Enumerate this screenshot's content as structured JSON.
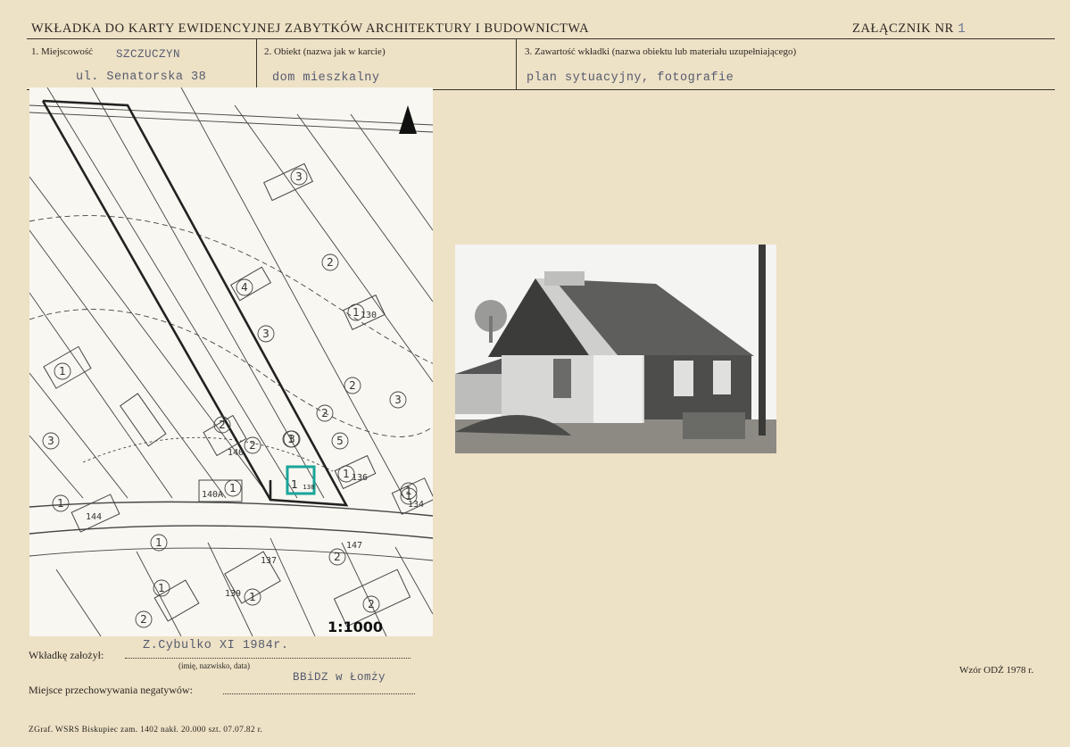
{
  "header": {
    "title": "WKŁADKA DO KARTY EWIDENCYJNEJ ZABYTKÓW ARCHITEKTURY I BUDOWNICTWA",
    "annex_label": "ZAŁĄCZNIK NR",
    "annex_number": "1"
  },
  "fields": {
    "locality_label": "1. Miejscowość",
    "locality_value": "SZCZUCZYN",
    "address_value": "ul. Senatorska 38",
    "object_label": "2. Obiekt (nazwa jak w karcie)",
    "object_value": "dom mieszkalny",
    "contents_label": "3. Zawartość wkładki (nazwa obiektu lub materiału uzupełniającego)",
    "contents_value": "plan sytuacyjny, fotografie"
  },
  "map": {
    "scale": "1:1000",
    "parcel_labels": [
      "3",
      "2",
      "4",
      "3",
      "1",
      "2",
      "3",
      "2",
      "5",
      "3",
      "1",
      "2",
      "1",
      "2",
      "1",
      "1",
      "3",
      "1",
      "1",
      "2",
      "1",
      "2",
      "1",
      "1",
      "2",
      "1"
    ],
    "house_numbers": [
      "130",
      "136",
      "134",
      "140",
      "140A",
      "144",
      "147",
      "137",
      "139"
    ],
    "highlighted_parcel": "1",
    "highlighted_number": "138"
  },
  "footer_fields": {
    "founder_label": "Wkładkę założył:",
    "founder_value": "Z.Cybulko XI 1984r.",
    "founder_caption": "(imię, nazwisko, data)",
    "storage_label": "Miejsce przechowywania negatywów:",
    "storage_value": "BBiDZ w Łomży",
    "printer": "ZGraf. WSRS Biskupiec zam. 1402 nakł. 20.000 szt. 07.07.82 r.",
    "pattern": "Wzór ODŻ 1978 r."
  }
}
